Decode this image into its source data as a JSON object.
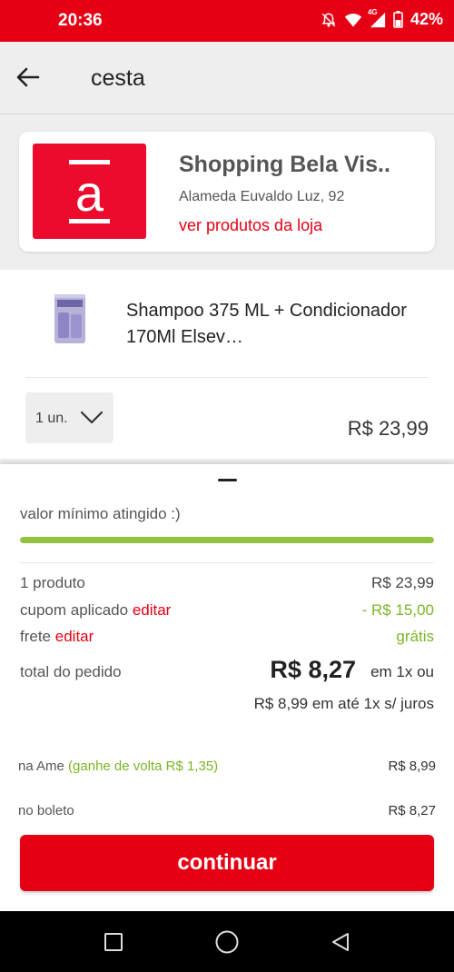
{
  "status_bar": {
    "time": "20:36",
    "network": "4G",
    "battery": "42%"
  },
  "header": {
    "title": "cesta",
    "back_icon": "arrow-left-icon"
  },
  "store": {
    "logo_letter": "a",
    "name": "Shopping Bela Vis..",
    "address": "Alameda Euvaldo Luz, 92",
    "link": "ver produtos da loja"
  },
  "product": {
    "name": "Shampoo 375 ML + Condicionador 170Ml Elsev…",
    "quantity": "1 un.",
    "price": "R$ 23,99"
  },
  "summary": {
    "min_value_text": "valor mínimo atingido :)",
    "min_progress": 1.0,
    "rows": {
      "products_label": "1 produto",
      "products_value": "R$ 23,99",
      "coupon_label": "cupom aplicado",
      "coupon_edit": "editar",
      "coupon_value": "- R$ 15,00",
      "shipping_label": "frete",
      "shipping_edit": "editar",
      "shipping_value": "grátis"
    },
    "total_label": "total do pedido",
    "total_amount": "R$ 8,27",
    "total_suffix": "em 1x ou",
    "installment": "R$ 8,99 em até 1x s/ juros",
    "payment": {
      "ame_label": "na Ame",
      "ame_cashback": "(ganhe de volta R$ 1,35)",
      "ame_value": "R$ 8,99",
      "boleto_label": "no boleto",
      "boleto_value": "R$ 8,27"
    },
    "continue_label": "continuar"
  },
  "colors": {
    "brand_red": "#e60014",
    "logo_red": "#ec0b2c",
    "success_green": "#7ab526",
    "progress_green": "#94c13e"
  }
}
